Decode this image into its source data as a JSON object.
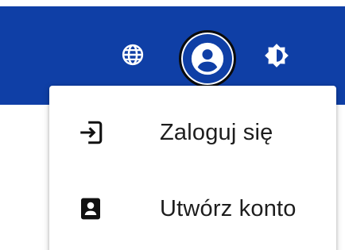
{
  "header": {
    "background_color": "#0f3fa6",
    "icons": {
      "language": "globe-icon",
      "account": "account-circle-icon",
      "theme": "brightness-icon"
    }
  },
  "account_menu": {
    "items": [
      {
        "icon": "login-icon",
        "label": "Zaloguj się"
      },
      {
        "icon": "contact-card-icon",
        "label": "Utwórz konto"
      }
    ]
  }
}
